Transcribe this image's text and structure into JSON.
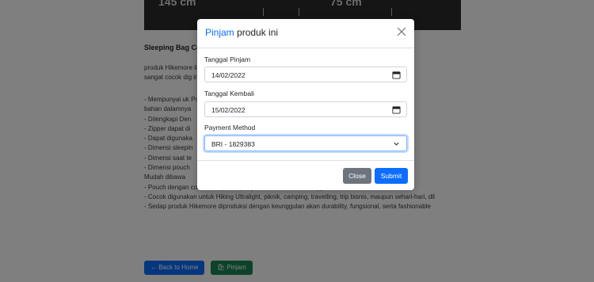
{
  "hero": {
    "left_size": "145 cm",
    "right_size": "75 cm"
  },
  "product": {
    "title": "Sleeping Bag Cr",
    "description_lines": [
      "produk Hikemore                                                                            ilan sehingga",
      "sangat cocok dig                                                                            ing."
    ],
    "features": [
      "- Mempunyai uk                                                                              Polyester dan",
      "bahan dalamnya",
      "- Dilengkapi Den",
      "- Zipper dapat di",
      "- Dapat digunaka",
      "- Dimensi sleepin",
      "- Dimensi saat te",
      "- Dimensi pouch",
      "  Mudah dibawa",
      "- Pouch dengan cord-lock system yang memiliki handle sehingga mudah dibawa kemanapun",
      "- Cocok digunakan untuk Hiking Ultralight, piknik, camping, travelling, trip bisnis, maupun sehari-hari, dll",
      "- Sedap produk Hikemore diproduksi dengan keunggulan akan durability, fungsional, serta fashionable"
    ],
    "back_button": "← Back to Home",
    "borrow_button": "🛍 Pinjam"
  },
  "modal": {
    "title_accent": "Pinjam",
    "title_rest": " produk ini",
    "borrow_date_label": "Tanggal Pinjam",
    "borrow_date_value": "14/02/2022",
    "return_date_label": "Tanggal Kembali",
    "return_date_value": "15/02/2022",
    "payment_label": "Payment Method",
    "payment_value": "BRI - 1829383",
    "close_button": "Close",
    "submit_button": "Submit"
  },
  "colors": {
    "primary": "#0d6efd",
    "secondary": "#6c757d",
    "success": "#198754",
    "backdrop": "rgba(0,0,0,0.5)"
  }
}
